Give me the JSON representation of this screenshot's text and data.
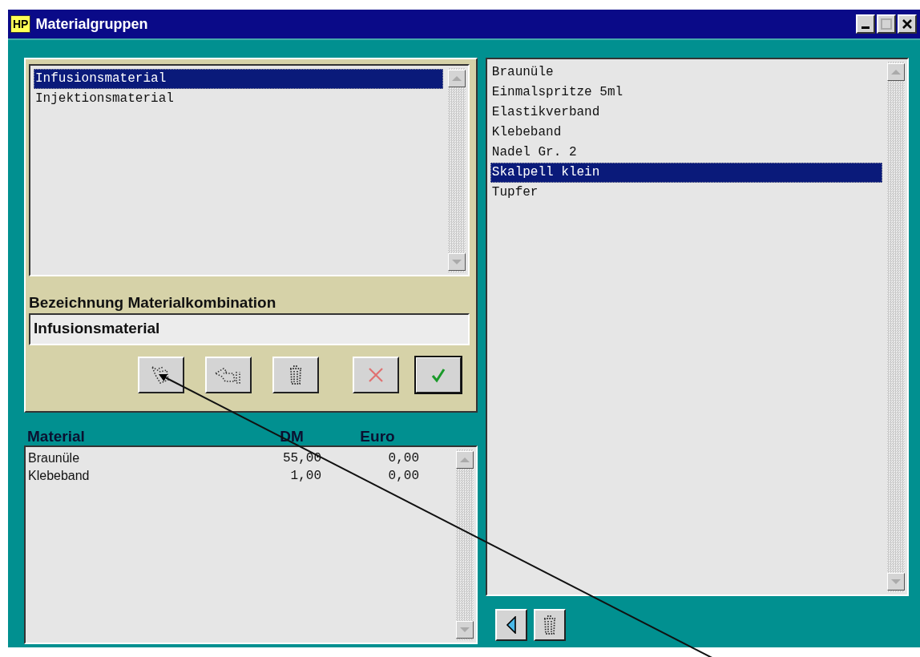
{
  "window": {
    "logo": "HP",
    "title": "Materialgruppen"
  },
  "groups_list": {
    "items": [
      {
        "label": "Infusionsmaterial",
        "selected": true
      },
      {
        "label": "Injektionsmaterial",
        "selected": false
      }
    ]
  },
  "name_field": {
    "label": "Bezeichnung Materialkombination",
    "value": "Infusionsmaterial"
  },
  "material_table": {
    "columns": [
      "Material",
      "DM",
      "Euro"
    ],
    "rows": [
      [
        "Braunüle",
        "55,00",
        "0,00"
      ],
      [
        "Klebeband",
        "1,00",
        "0,00"
      ]
    ]
  },
  "materials_list": {
    "items": [
      {
        "label": "Braunüle",
        "selected": false
      },
      {
        "label": "Einmalspritze 5ml",
        "selected": false
      },
      {
        "label": "Elastikverband",
        "selected": false
      },
      {
        "label": "Klebeband",
        "selected": false
      },
      {
        "label": "Nadel Gr. 2",
        "selected": false
      },
      {
        "label": "Skalpell klein",
        "selected": true
      },
      {
        "label": "Tupfer",
        "selected": false
      }
    ]
  }
}
